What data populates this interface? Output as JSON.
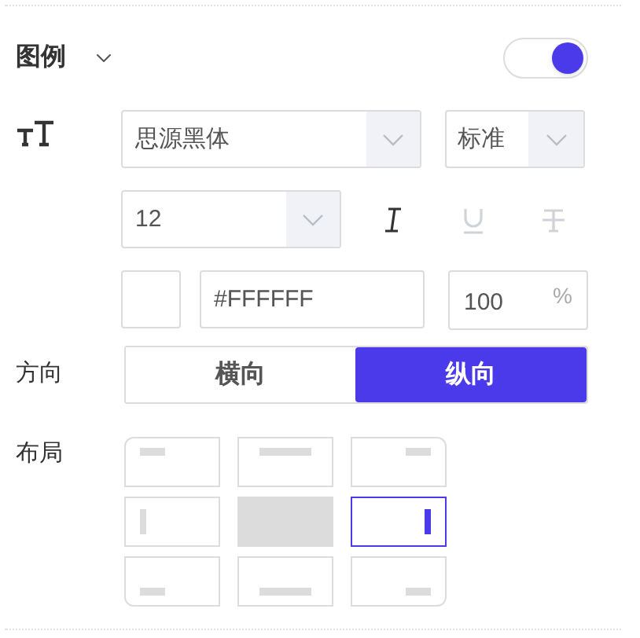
{
  "section": {
    "title": "图例",
    "expanded": true,
    "enabled": true
  },
  "font": {
    "family": "思源黑体",
    "weight": "标准",
    "size": "12"
  },
  "styles": [
    {
      "kind": "italic",
      "active": true
    },
    {
      "kind": "underline",
      "active": false
    },
    {
      "kind": "strikethrough",
      "active": false
    }
  ],
  "color": {
    "value": "#FFFFFF",
    "opacity": "100",
    "unit": "%"
  },
  "direction": {
    "label": "方向",
    "options": [
      {
        "label": "横向",
        "selected": false
      },
      {
        "label": "纵向",
        "selected": true
      }
    ]
  },
  "layout": {
    "label": "布局",
    "cells": [
      {
        "kind": "top-left",
        "selected": false,
        "disabled": false
      },
      {
        "kind": "top-center",
        "selected": false,
        "disabled": false
      },
      {
        "kind": "top-right",
        "selected": false,
        "disabled": false
      },
      {
        "kind": "middle-left",
        "selected": false,
        "disabled": false
      },
      {
        "kind": "middle-center",
        "selected": false,
        "disabled": true
      },
      {
        "kind": "middle-right",
        "selected": true,
        "disabled": false
      },
      {
        "kind": "bottom-left",
        "selected": false,
        "disabled": false
      },
      {
        "kind": "bottom-center",
        "selected": false,
        "disabled": false
      },
      {
        "kind": "bottom-right",
        "selected": false,
        "disabled": false
      }
    ]
  }
}
